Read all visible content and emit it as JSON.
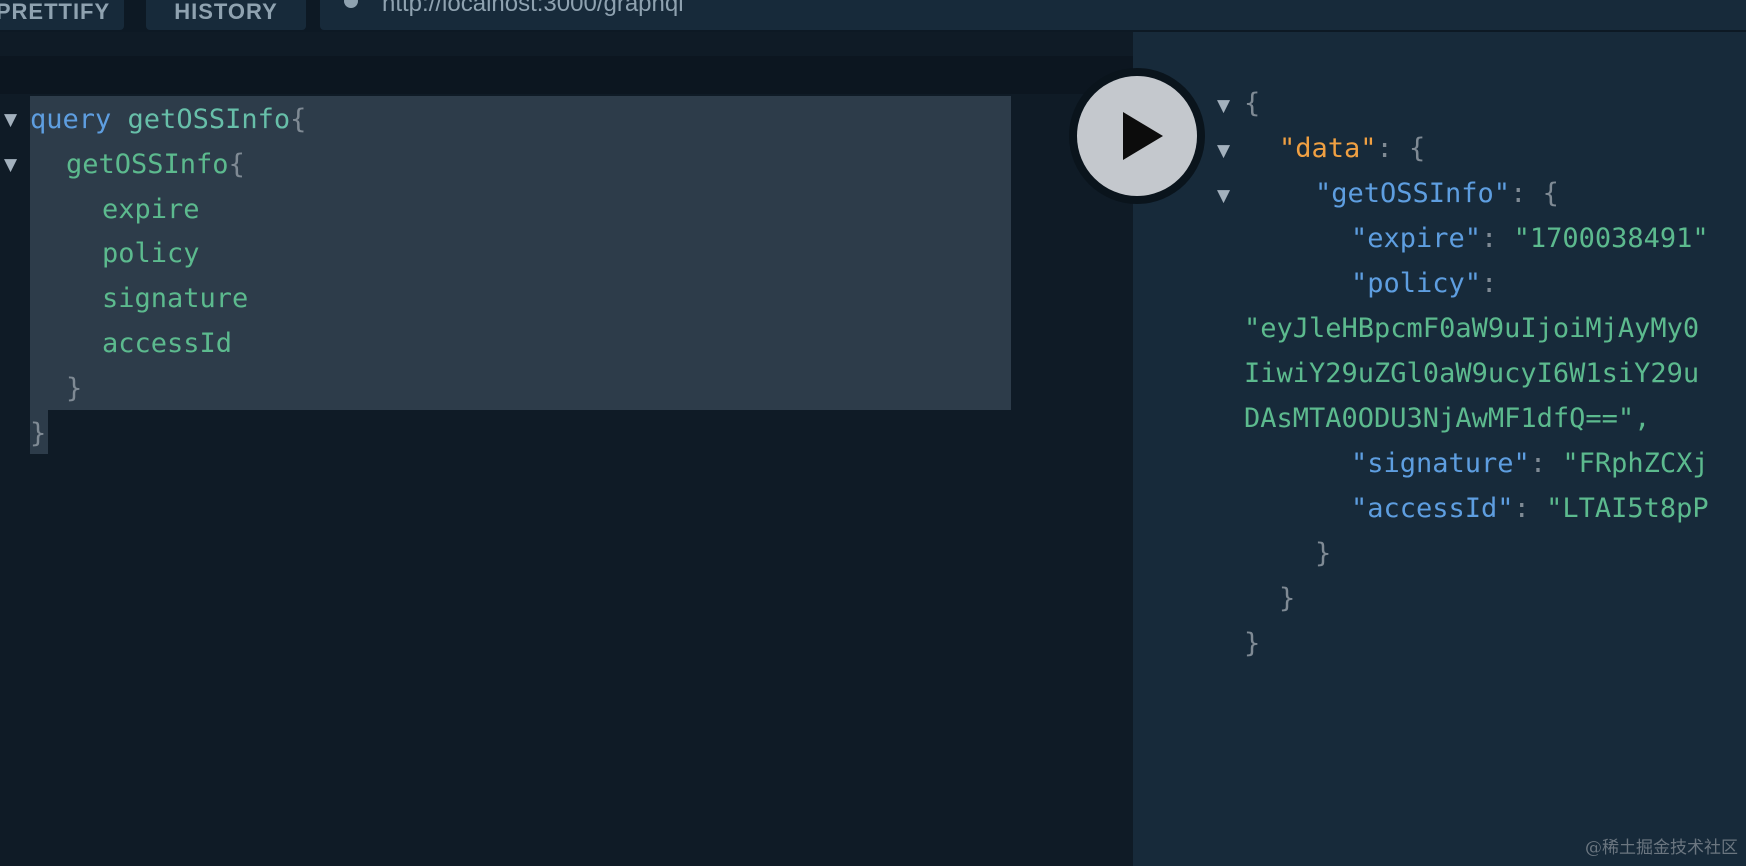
{
  "toolbar": {
    "prettify_label": "PRETTIFY",
    "history_label": "HISTORY",
    "url": "http://localhost:3000/graphql"
  },
  "query_editor": {
    "lines": [
      {
        "keyword": "query",
        "name": "getOSSInfo",
        "brace": "{"
      },
      {
        "field": "getOSSInfo",
        "brace": "{"
      },
      {
        "field": "expire"
      },
      {
        "field": "policy"
      },
      {
        "field": "signature"
      },
      {
        "field": "accessId"
      },
      {
        "brace": "}"
      },
      {
        "brace": "}"
      }
    ]
  },
  "result": {
    "open_brace": "{",
    "data_key": "\"data\"",
    "colon_brace": ": {",
    "getossinfo_key": "\"getOSSInfo\"",
    "expire_key": "\"expire\"",
    "expire_value": "\"1700038491\"",
    "policy_key": "\"policy\"",
    "policy_value_line1": "\"eyJleHBpcmF0aW9uIjoiMjAyMy0",
    "policy_value_line2": "IiwiY29uZGl0aW9ucyI6W1siY29u",
    "policy_value_line3": "DAsMTA0ODU3NjAwMF1dfQ==\",",
    "signature_key": "\"signature\"",
    "signature_value": "\"FRphZCXj",
    "accessid_key": "\"accessId\"",
    "accessid_value": "\"LTAI5t8pP",
    "close_brace": "}"
  },
  "colors": {
    "background": "#0f1b26",
    "result_background": "#172a3a",
    "keyword": "#5e9ee0",
    "field": "#5cba8e",
    "data_key": "#f0a042"
  },
  "icons": {
    "fold_arrow": "triangle-down-icon",
    "run_button": "play-icon"
  },
  "watermark": "@稀土掘金技术社区"
}
